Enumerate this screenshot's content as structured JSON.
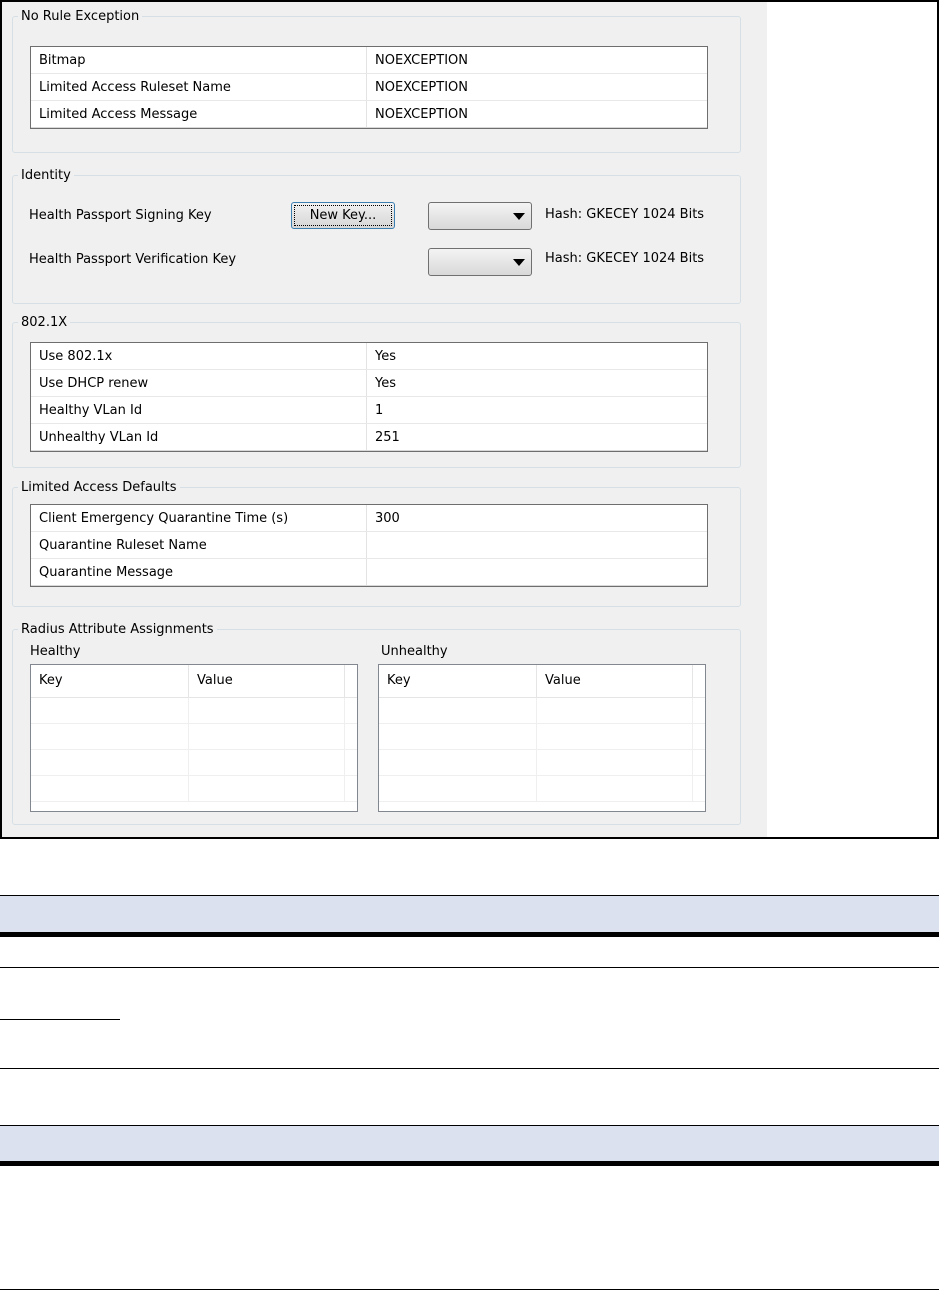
{
  "no_rule_exception": {
    "title": "No Rule Exception",
    "rows": [
      {
        "key": "Bitmap",
        "value": "NOEXCEPTION"
      },
      {
        "key": "Limited Access Ruleset Name",
        "value": "NOEXCEPTION"
      },
      {
        "key": "Limited Access Message",
        "value": "NOEXCEPTION"
      }
    ]
  },
  "identity": {
    "title": "Identity",
    "signing_key_label": "Health Passport Signing Key",
    "new_key_button": "New Key...",
    "signing_hash": "Hash: GKECEY 1024 Bits",
    "verification_key_label": "Health Passport Verification Key",
    "verification_hash": "Hash: GKECEY 1024 Bits"
  },
  "dot1x": {
    "title": "802.1X",
    "rows": [
      {
        "key": "Use 802.1x",
        "value": "Yes"
      },
      {
        "key": "Use DHCP renew",
        "value": "Yes"
      },
      {
        "key": "Healthy VLan Id",
        "value": "1"
      },
      {
        "key": "Unhealthy VLan Id",
        "value": "251"
      }
    ]
  },
  "limited_access_defaults": {
    "title": "Limited Access Defaults",
    "rows": [
      {
        "key": "Client Emergency Quarantine Time (s)",
        "value": "300"
      },
      {
        "key": "Quarantine Ruleset Name",
        "value": ""
      },
      {
        "key": "Quarantine Message",
        "value": ""
      }
    ]
  },
  "radius": {
    "title": "Radius Attribute Assignments",
    "healthy": {
      "label": "Healthy",
      "col_key": "Key",
      "col_value": "Value"
    },
    "unhealthy": {
      "label": "Unhealthy",
      "col_key": "Key",
      "col_value": "Value"
    }
  },
  "colors": {
    "dialog_bg": "#f0f0f0",
    "group_border": "#d5dfe5",
    "doc_band": "#dce1ef"
  }
}
